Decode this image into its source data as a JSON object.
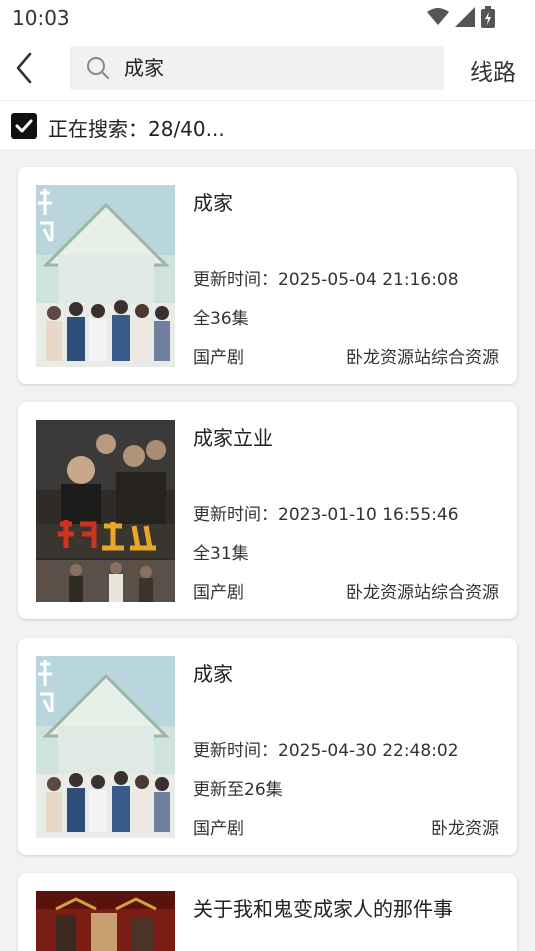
{
  "status_bar": {
    "time": "10:03"
  },
  "header": {
    "search_value": "成家",
    "route_label": "线路"
  },
  "search_status": {
    "text": "正在搜索：28/40..."
  },
  "results": [
    {
      "title": "成家",
      "update_time": "更新时间：2025-05-04 21:16:08",
      "episodes": "全36集",
      "genre": "国产剧",
      "source": "卧龙资源站综合资源"
    },
    {
      "title": "成家立业",
      "update_time": "更新时间：2023-01-10 16:55:46",
      "episodes": "全31集",
      "genre": "国产剧",
      "source": "卧龙资源站综合资源"
    },
    {
      "title": "成家",
      "update_time": "更新时间：2025-04-30 22:48:02",
      "episodes": "更新至26集",
      "genre": "国产剧",
      "source": "卧龙资源"
    },
    {
      "title": "关于我和鬼变成家人的那件事"
    }
  ],
  "icons": {
    "wifi": "wifi-icon",
    "signal": "signal-icon",
    "battery": "battery-icon",
    "back": "back-arrow-icon",
    "search": "search-icon",
    "checkbox": "checkbox-checked-icon"
  }
}
